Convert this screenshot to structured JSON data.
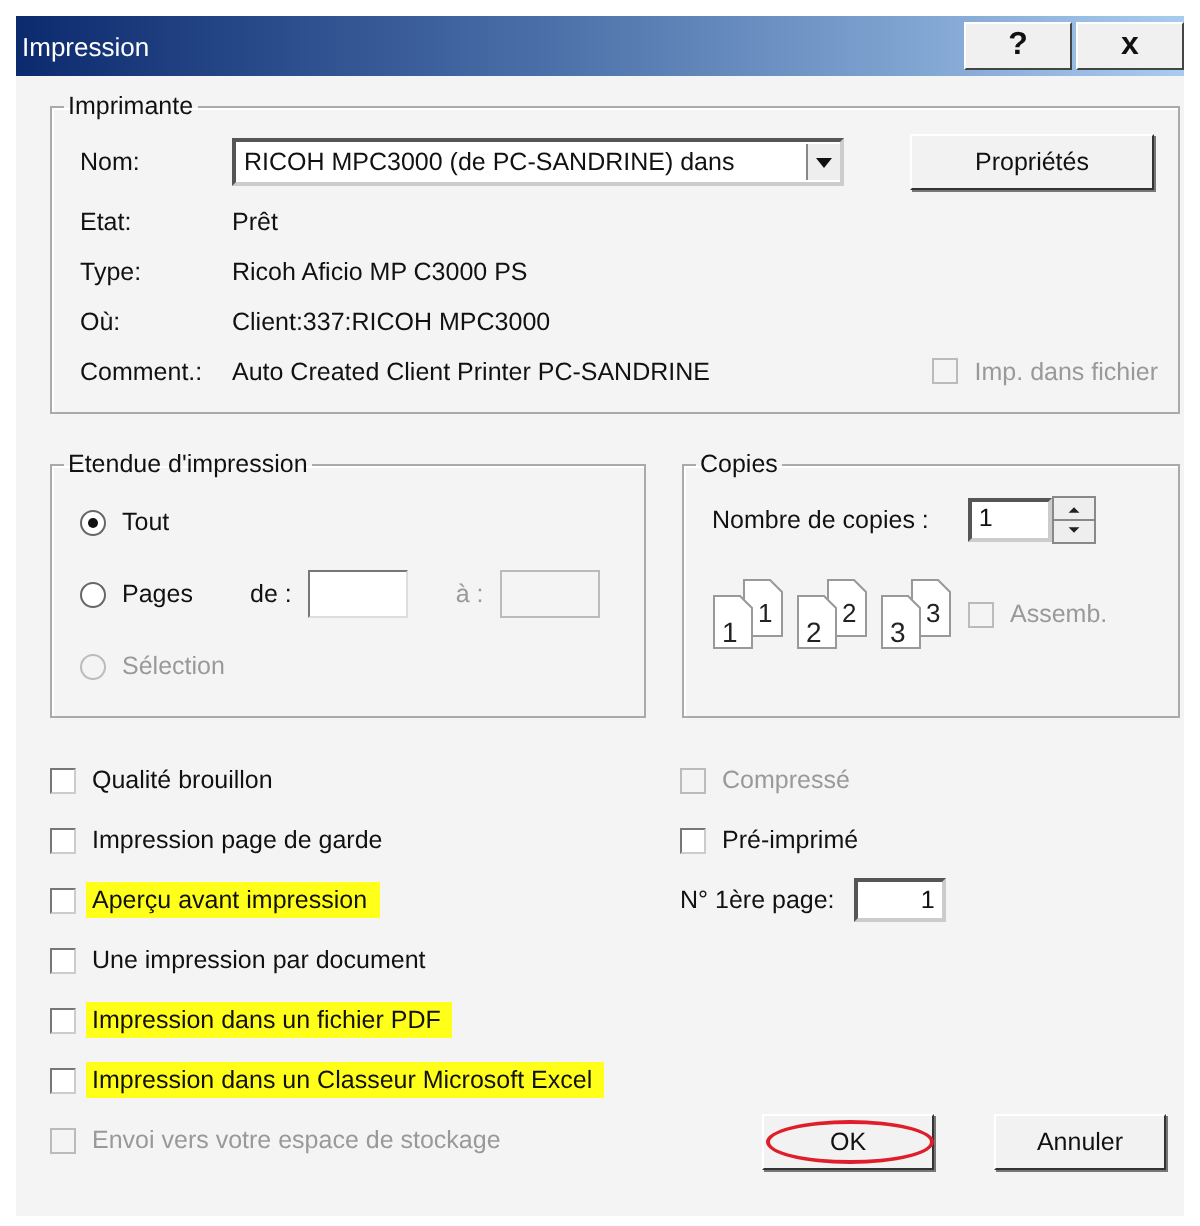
{
  "window": {
    "title": "Impression",
    "help_button": "?",
    "close_button": "x"
  },
  "printer": {
    "title": "Imprimante",
    "name_label": "Nom:",
    "name_value": "RICOH MPC3000 (de PC-SANDRINE) dans",
    "properties_button": "Propriétés",
    "info": [
      {
        "label": "Etat:",
        "value": "Prêt"
      },
      {
        "label": "Type:",
        "value": "Ricoh Aficio MP C3000 PS"
      },
      {
        "label": "Où:",
        "value": "Client:337:RICOH MPC3000"
      },
      {
        "label": "Comment.:",
        "value": "Auto Created Client Printer PC-SANDRINE"
      }
    ],
    "print_to_file": {
      "label": "Imp. dans fichier",
      "checked": false,
      "disabled": true
    }
  },
  "range": {
    "title": "Etendue d'impression",
    "options": [
      {
        "label": "Tout",
        "selected": true,
        "disabled": false
      },
      {
        "label": "Pages",
        "selected": false,
        "disabled": false
      },
      {
        "label": "Sélection",
        "selected": false,
        "disabled": true
      }
    ],
    "from": {
      "label": "de :",
      "disabled": false
    },
    "to": {
      "label": "à :",
      "disabled": true
    }
  },
  "copies": {
    "title": "Copies",
    "count_label": "Nombre de copies :",
    "count": "1",
    "pages": [
      {
        "front": "1",
        "back": "1"
      },
      {
        "front": "2",
        "back": "2"
      },
      {
        "front": "3",
        "back": "3"
      }
    ],
    "collate": {
      "label": "Assemb.",
      "checked": false,
      "disabled": true
    }
  },
  "options_left": [
    {
      "label": "Qualité brouillon",
      "checked": false,
      "disabled": false,
      "highlighted": false
    },
    {
      "label": "Impression page de garde",
      "checked": false,
      "disabled": false,
      "highlighted": false
    },
    {
      "label": "Aperçu avant impression",
      "checked": false,
      "disabled": false,
      "highlighted": true
    },
    {
      "label": "Une impression par document",
      "checked": false,
      "disabled": false,
      "highlighted": false
    },
    {
      "label": "Impression dans un fichier PDF",
      "checked": false,
      "disabled": false,
      "highlighted": true
    },
    {
      "label": "Impression dans un Classeur Microsoft Excel",
      "checked": false,
      "disabled": false,
      "highlighted": true
    },
    {
      "label": "Envoi vers votre espace de stockage",
      "checked": false,
      "disabled": true,
      "highlighted": false
    }
  ],
  "options_right": [
    {
      "kind": "checkbox",
      "label": "Compressé",
      "checked": false,
      "disabled": true
    },
    {
      "kind": "checkbox",
      "label": "Pré-imprimé",
      "checked": false,
      "disabled": false
    },
    {
      "kind": "number",
      "label": "N° 1ère page:",
      "value": "1"
    }
  ],
  "buttons": [
    {
      "label": "OK",
      "circled": true
    },
    {
      "label": "Annuler",
      "circled": false
    }
  ]
}
